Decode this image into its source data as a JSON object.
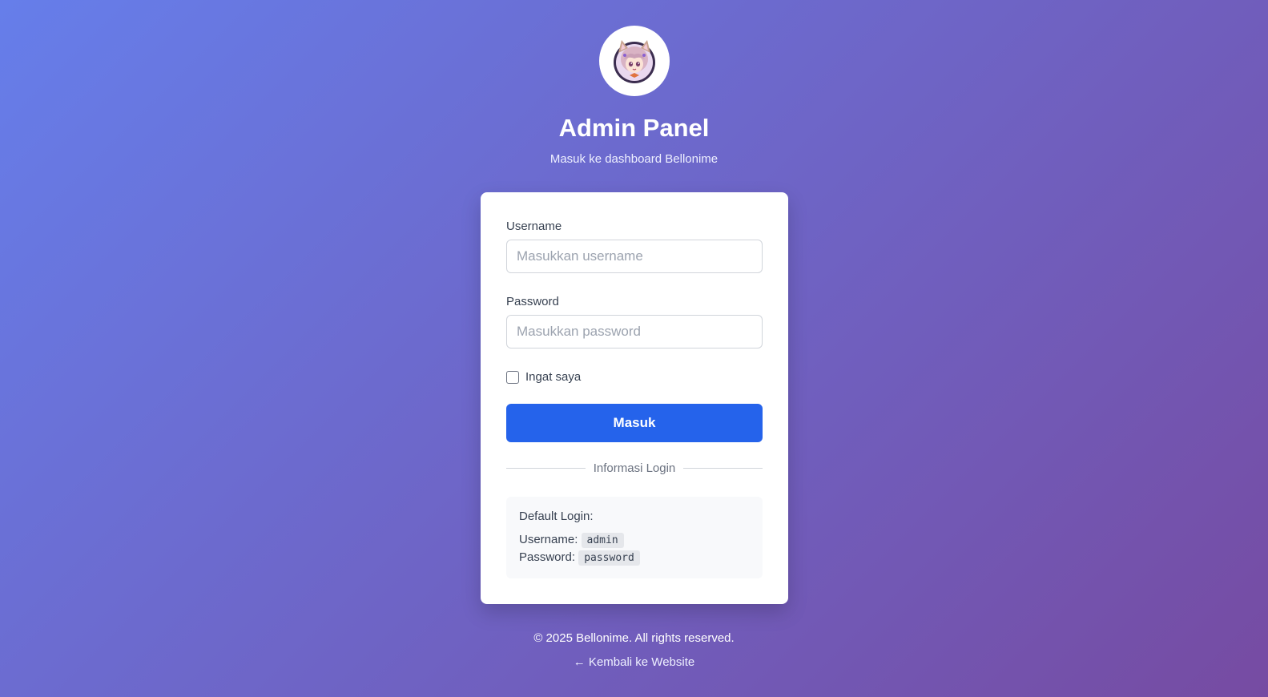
{
  "header": {
    "logo_icon": "anime-avatar-logo",
    "title": "Admin Panel",
    "subtitle": "Masuk ke dashboard Bellonime"
  },
  "form": {
    "username_label": "Username",
    "username_placeholder": "Masukkan username",
    "username_value": "",
    "password_label": "Password",
    "password_placeholder": "Masukkan password",
    "password_value": "",
    "remember_label": "Ingat saya",
    "remember_checked": false,
    "submit_label": "Masuk"
  },
  "divider": {
    "label": "Informasi Login"
  },
  "info": {
    "title": "Default Login:",
    "username_label": "Username:",
    "username_value": "admin",
    "password_label": "Password:",
    "password_value": "password"
  },
  "footer": {
    "copyright": "© 2025 Bellonime. All rights reserved.",
    "back_link": "← Kembali ke Website"
  },
  "colors": {
    "gradient_start": "#667eea",
    "gradient_end": "#764ba2",
    "primary_button": "#2563eb"
  }
}
